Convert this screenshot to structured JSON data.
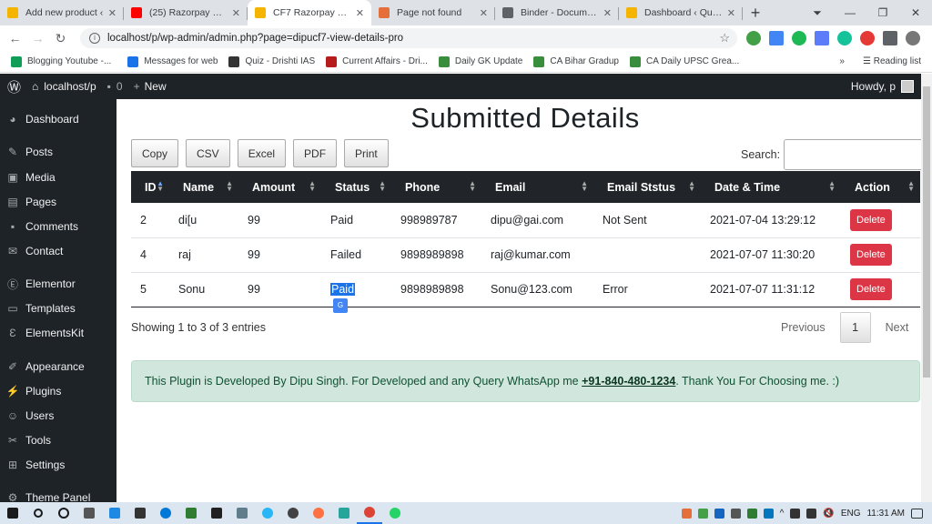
{
  "browser": {
    "tabs": [
      {
        "title": "Add new product ‹",
        "color": "#f4b400"
      },
      {
        "title": "(25) Razorpay Conta",
        "color": "#ff0000"
      },
      {
        "title": "CF7 Razorpay Pro ‹",
        "color": "#f4b400",
        "active": true
      },
      {
        "title": "Page not found",
        "color": "#e56f3a"
      },
      {
        "title": "Binder - Documenta",
        "color": "#5f6368"
      },
      {
        "title": "Dashboard ‹ Quant",
        "color": "#f4b400"
      }
    ],
    "url": "localhost/p/wp-admin/admin.php?page=dipucf7-view-details-pro",
    "bookmarks": [
      {
        "label": "Blogging Youtube -...",
        "color": "#0f9d58"
      },
      {
        "label": "Messages for web",
        "color": "#1a73e8"
      },
      {
        "label": "Quiz - Drishti IAS",
        "color": "#333333"
      },
      {
        "label": "Current Affairs - Dri...",
        "color": "#b71c1c"
      },
      {
        "label": "Daily GK Update",
        "color": "#388e3c"
      },
      {
        "label": "CA Bihar Gradup",
        "color": "#388e3c"
      },
      {
        "label": "CA Daily UPSC Grea...",
        "color": "#388e3c"
      }
    ],
    "reading_list": "Reading list"
  },
  "wpbar": {
    "site": "localhost/p",
    "comments": "0",
    "new": "New",
    "howdy": "Howdy, p"
  },
  "sidebar": [
    {
      "label": "Dashboard",
      "icon": "dashboard-icon"
    },
    {
      "label": "Posts",
      "icon": "pin-icon"
    },
    {
      "label": "Media",
      "icon": "media-icon"
    },
    {
      "label": "Pages",
      "icon": "pages-icon"
    },
    {
      "label": "Comments",
      "icon": "comments-icon"
    },
    {
      "label": "Contact",
      "icon": "mail-icon"
    },
    {
      "label": "Elementor",
      "icon": "elementor-icon"
    },
    {
      "label": "Templates",
      "icon": "templates-icon"
    },
    {
      "label": "ElementsKit",
      "icon": "elementskit-icon"
    },
    {
      "label": "Appearance",
      "icon": "brush-icon"
    },
    {
      "label": "Plugins",
      "icon": "plugin-icon"
    },
    {
      "label": "Users",
      "icon": "users-icon"
    },
    {
      "label": "Tools",
      "icon": "wrench-icon"
    },
    {
      "label": "Settings",
      "icon": "settings-icon"
    },
    {
      "label": "Theme Panel",
      "icon": "theme-icon"
    }
  ],
  "page": {
    "title": "Submitted Details",
    "buttons": [
      "Copy",
      "CSV",
      "Excel",
      "PDF",
      "Print"
    ],
    "search_label": "Search:",
    "columns": [
      "ID",
      "Name",
      "Amount",
      "Status",
      "Phone",
      "Email",
      "Email Ststus",
      "Date & Time",
      "Action"
    ],
    "rows": [
      [
        "2",
        "di[u",
        "99",
        "Paid",
        "998989787",
        "dipu@gai.com",
        "Not Sent",
        "2021-07-04 13:29:12",
        "Delete"
      ],
      [
        "4",
        "raj",
        "99",
        "Failed",
        "9898989898",
        "raj@kumar.com",
        "",
        "2021-07-07 11:30:20",
        "Delete"
      ],
      [
        "5",
        "Sonu",
        "99",
        "Paid",
        "9898989898",
        "Sonu@123.com",
        "Error",
        "2021-07-07 11:31:12",
        "Delete"
      ]
    ],
    "info": "Showing 1 to 3 of 3 entries",
    "pager": {
      "previous": "Previous",
      "page": "1",
      "next": "Next"
    },
    "notice": {
      "before": "This Plugin is Developed By Dipu Singh. For Developed and any Query WhatsApp me ",
      "phone": "+91-840-480-1234",
      "after": ". Thank You For Choosing me. :)"
    }
  },
  "taskbar": {
    "lang": "ENG",
    "time": "11:31 AM"
  }
}
